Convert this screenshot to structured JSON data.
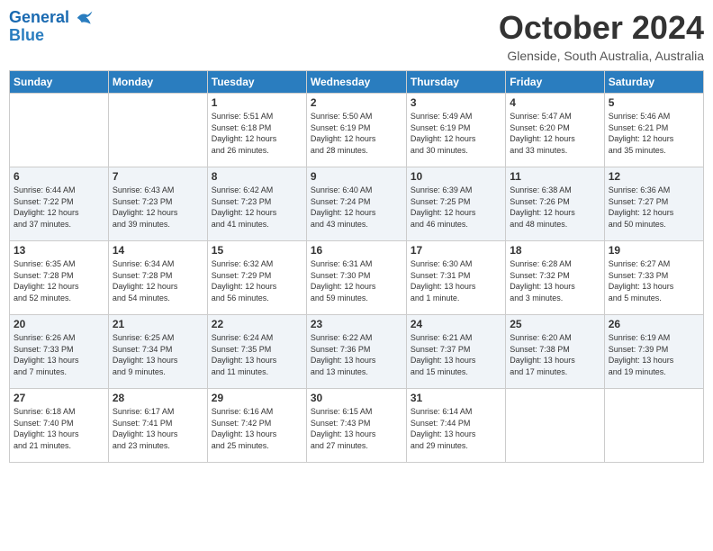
{
  "header": {
    "logo_line1": "General",
    "logo_line2": "Blue",
    "title": "October 2024",
    "location": "Glenside, South Australia, Australia"
  },
  "weekdays": [
    "Sunday",
    "Monday",
    "Tuesday",
    "Wednesday",
    "Thursday",
    "Friday",
    "Saturday"
  ],
  "weeks": [
    [
      {
        "num": "",
        "info": ""
      },
      {
        "num": "",
        "info": ""
      },
      {
        "num": "1",
        "info": "Sunrise: 5:51 AM\nSunset: 6:18 PM\nDaylight: 12 hours\nand 26 minutes."
      },
      {
        "num": "2",
        "info": "Sunrise: 5:50 AM\nSunset: 6:19 PM\nDaylight: 12 hours\nand 28 minutes."
      },
      {
        "num": "3",
        "info": "Sunrise: 5:49 AM\nSunset: 6:19 PM\nDaylight: 12 hours\nand 30 minutes."
      },
      {
        "num": "4",
        "info": "Sunrise: 5:47 AM\nSunset: 6:20 PM\nDaylight: 12 hours\nand 33 minutes."
      },
      {
        "num": "5",
        "info": "Sunrise: 5:46 AM\nSunset: 6:21 PM\nDaylight: 12 hours\nand 35 minutes."
      }
    ],
    [
      {
        "num": "6",
        "info": "Sunrise: 6:44 AM\nSunset: 7:22 PM\nDaylight: 12 hours\nand 37 minutes."
      },
      {
        "num": "7",
        "info": "Sunrise: 6:43 AM\nSunset: 7:23 PM\nDaylight: 12 hours\nand 39 minutes."
      },
      {
        "num": "8",
        "info": "Sunrise: 6:42 AM\nSunset: 7:23 PM\nDaylight: 12 hours\nand 41 minutes."
      },
      {
        "num": "9",
        "info": "Sunrise: 6:40 AM\nSunset: 7:24 PM\nDaylight: 12 hours\nand 43 minutes."
      },
      {
        "num": "10",
        "info": "Sunrise: 6:39 AM\nSunset: 7:25 PM\nDaylight: 12 hours\nand 46 minutes."
      },
      {
        "num": "11",
        "info": "Sunrise: 6:38 AM\nSunset: 7:26 PM\nDaylight: 12 hours\nand 48 minutes."
      },
      {
        "num": "12",
        "info": "Sunrise: 6:36 AM\nSunset: 7:27 PM\nDaylight: 12 hours\nand 50 minutes."
      }
    ],
    [
      {
        "num": "13",
        "info": "Sunrise: 6:35 AM\nSunset: 7:28 PM\nDaylight: 12 hours\nand 52 minutes."
      },
      {
        "num": "14",
        "info": "Sunrise: 6:34 AM\nSunset: 7:28 PM\nDaylight: 12 hours\nand 54 minutes."
      },
      {
        "num": "15",
        "info": "Sunrise: 6:32 AM\nSunset: 7:29 PM\nDaylight: 12 hours\nand 56 minutes."
      },
      {
        "num": "16",
        "info": "Sunrise: 6:31 AM\nSunset: 7:30 PM\nDaylight: 12 hours\nand 59 minutes."
      },
      {
        "num": "17",
        "info": "Sunrise: 6:30 AM\nSunset: 7:31 PM\nDaylight: 13 hours\nand 1 minute."
      },
      {
        "num": "18",
        "info": "Sunrise: 6:28 AM\nSunset: 7:32 PM\nDaylight: 13 hours\nand 3 minutes."
      },
      {
        "num": "19",
        "info": "Sunrise: 6:27 AM\nSunset: 7:33 PM\nDaylight: 13 hours\nand 5 minutes."
      }
    ],
    [
      {
        "num": "20",
        "info": "Sunrise: 6:26 AM\nSunset: 7:33 PM\nDaylight: 13 hours\nand 7 minutes."
      },
      {
        "num": "21",
        "info": "Sunrise: 6:25 AM\nSunset: 7:34 PM\nDaylight: 13 hours\nand 9 minutes."
      },
      {
        "num": "22",
        "info": "Sunrise: 6:24 AM\nSunset: 7:35 PM\nDaylight: 13 hours\nand 11 minutes."
      },
      {
        "num": "23",
        "info": "Sunrise: 6:22 AM\nSunset: 7:36 PM\nDaylight: 13 hours\nand 13 minutes."
      },
      {
        "num": "24",
        "info": "Sunrise: 6:21 AM\nSunset: 7:37 PM\nDaylight: 13 hours\nand 15 minutes."
      },
      {
        "num": "25",
        "info": "Sunrise: 6:20 AM\nSunset: 7:38 PM\nDaylight: 13 hours\nand 17 minutes."
      },
      {
        "num": "26",
        "info": "Sunrise: 6:19 AM\nSunset: 7:39 PM\nDaylight: 13 hours\nand 19 minutes."
      }
    ],
    [
      {
        "num": "27",
        "info": "Sunrise: 6:18 AM\nSunset: 7:40 PM\nDaylight: 13 hours\nand 21 minutes."
      },
      {
        "num": "28",
        "info": "Sunrise: 6:17 AM\nSunset: 7:41 PM\nDaylight: 13 hours\nand 23 minutes."
      },
      {
        "num": "29",
        "info": "Sunrise: 6:16 AM\nSunset: 7:42 PM\nDaylight: 13 hours\nand 25 minutes."
      },
      {
        "num": "30",
        "info": "Sunrise: 6:15 AM\nSunset: 7:43 PM\nDaylight: 13 hours\nand 27 minutes."
      },
      {
        "num": "31",
        "info": "Sunrise: 6:14 AM\nSunset: 7:44 PM\nDaylight: 13 hours\nand 29 minutes."
      },
      {
        "num": "",
        "info": ""
      },
      {
        "num": "",
        "info": ""
      }
    ]
  ]
}
